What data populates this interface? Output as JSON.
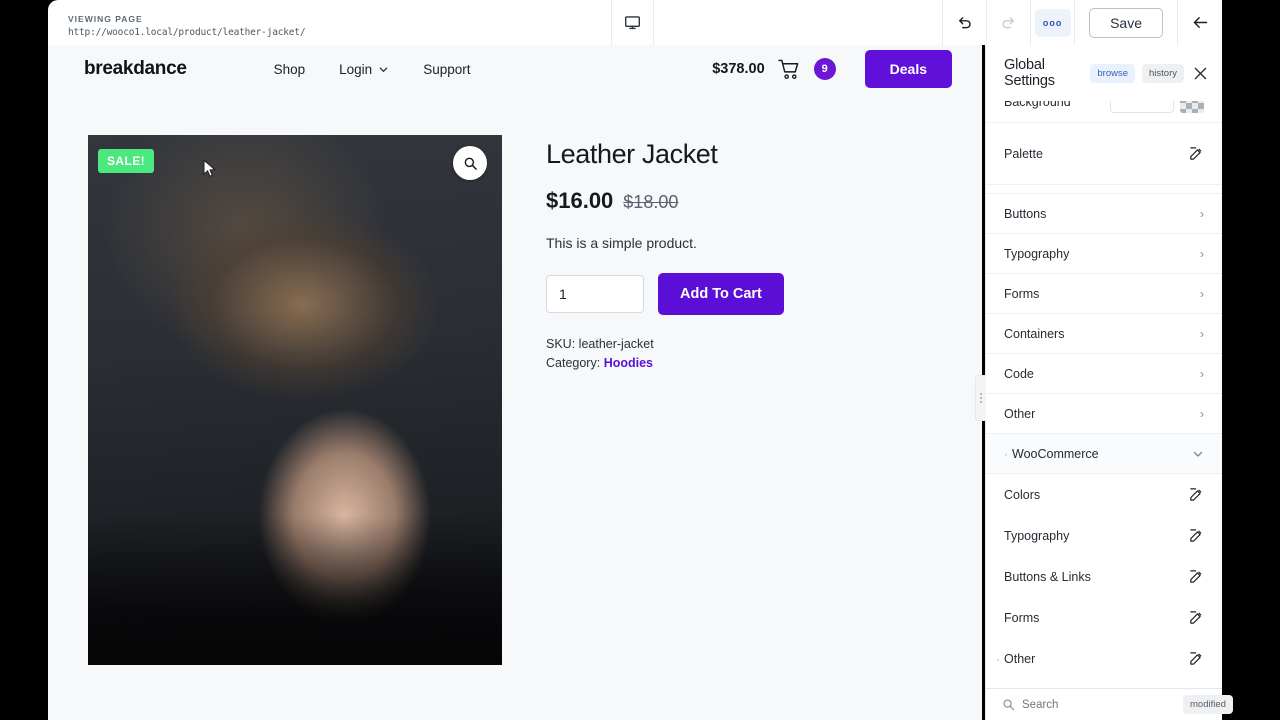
{
  "topbar": {
    "viewing_label": "VIEWING PAGE",
    "viewing_url": "http://wooco1.local/product/leather-jacket/",
    "device_icon": "desktop-monitor-icon",
    "undo_icon": "undo-arrow-icon",
    "redo_icon": "redo-arrow-icon",
    "more_label": "ooo",
    "save_label": "Save",
    "back_icon": "arrow-left-icon"
  },
  "site": {
    "brand": "breakdance",
    "nav": [
      {
        "label": "Shop",
        "has_caret": false
      },
      {
        "label": "Login",
        "has_caret": true
      },
      {
        "label": "Support",
        "has_caret": false
      }
    ],
    "cart_total": "$378.00",
    "cart_count": "9",
    "deals_label": "Deals",
    "accent_color": "#6010d8"
  },
  "product": {
    "sale_badge": "SALE!",
    "sale_badge_color": "#4ae87e",
    "zoom_icon": "magnifier-icon",
    "title": "Leather Jacket",
    "price": "$16.00",
    "price_old": "$18.00",
    "description": "This is a simple product.",
    "quantity_value": "1",
    "quantity_placeholder": "1",
    "add_to_cart_label": "Add To Cart",
    "sku_label": "SKU:",
    "sku_value": "leather-jacket",
    "category_label": "Category:",
    "category_value": "Hoodies"
  },
  "panel": {
    "title": "Global Settings",
    "browse_label": "browse",
    "history_label": "history",
    "close_icon": "close-x-icon",
    "background": {
      "label": "Background",
      "color_value": "",
      "swatch": "transparent-checkerboard"
    },
    "palette": {
      "label": "Palette",
      "icon": "edit-pencil-icon"
    },
    "sections": [
      {
        "label": "Buttons",
        "chevron": "chevron-right-icon",
        "expanded": false,
        "marker": false
      },
      {
        "label": "Typography",
        "chevron": "chevron-right-icon",
        "expanded": false,
        "marker": false
      },
      {
        "label": "Forms",
        "chevron": "chevron-right-icon",
        "expanded": false,
        "marker": false
      },
      {
        "label": "Containers",
        "chevron": "chevron-right-icon",
        "expanded": false,
        "marker": false
      },
      {
        "label": "Code",
        "chevron": "chevron-right-icon",
        "expanded": false,
        "marker": false
      },
      {
        "label": "Other",
        "chevron": "chevron-right-icon",
        "expanded": false,
        "marker": false
      },
      {
        "label": "WooCommerce",
        "chevron": "chevron-down-icon",
        "expanded": true,
        "marker": true
      }
    ],
    "woocommerce_items": [
      {
        "label": "Colors",
        "icon": "edit-pencil-icon",
        "marker": false
      },
      {
        "label": "Typography",
        "icon": "edit-pencil-icon",
        "marker": false
      },
      {
        "label": "Buttons & Links",
        "icon": "edit-pencil-icon",
        "marker": false
      },
      {
        "label": "Forms",
        "icon": "edit-pencil-icon",
        "marker": false
      },
      {
        "label": "Other",
        "icon": "edit-pencil-icon",
        "marker": true
      }
    ],
    "search_placeholder": "Search",
    "search_value": "",
    "search_icon": "search-magnifier-icon",
    "modified_label": "modified"
  }
}
